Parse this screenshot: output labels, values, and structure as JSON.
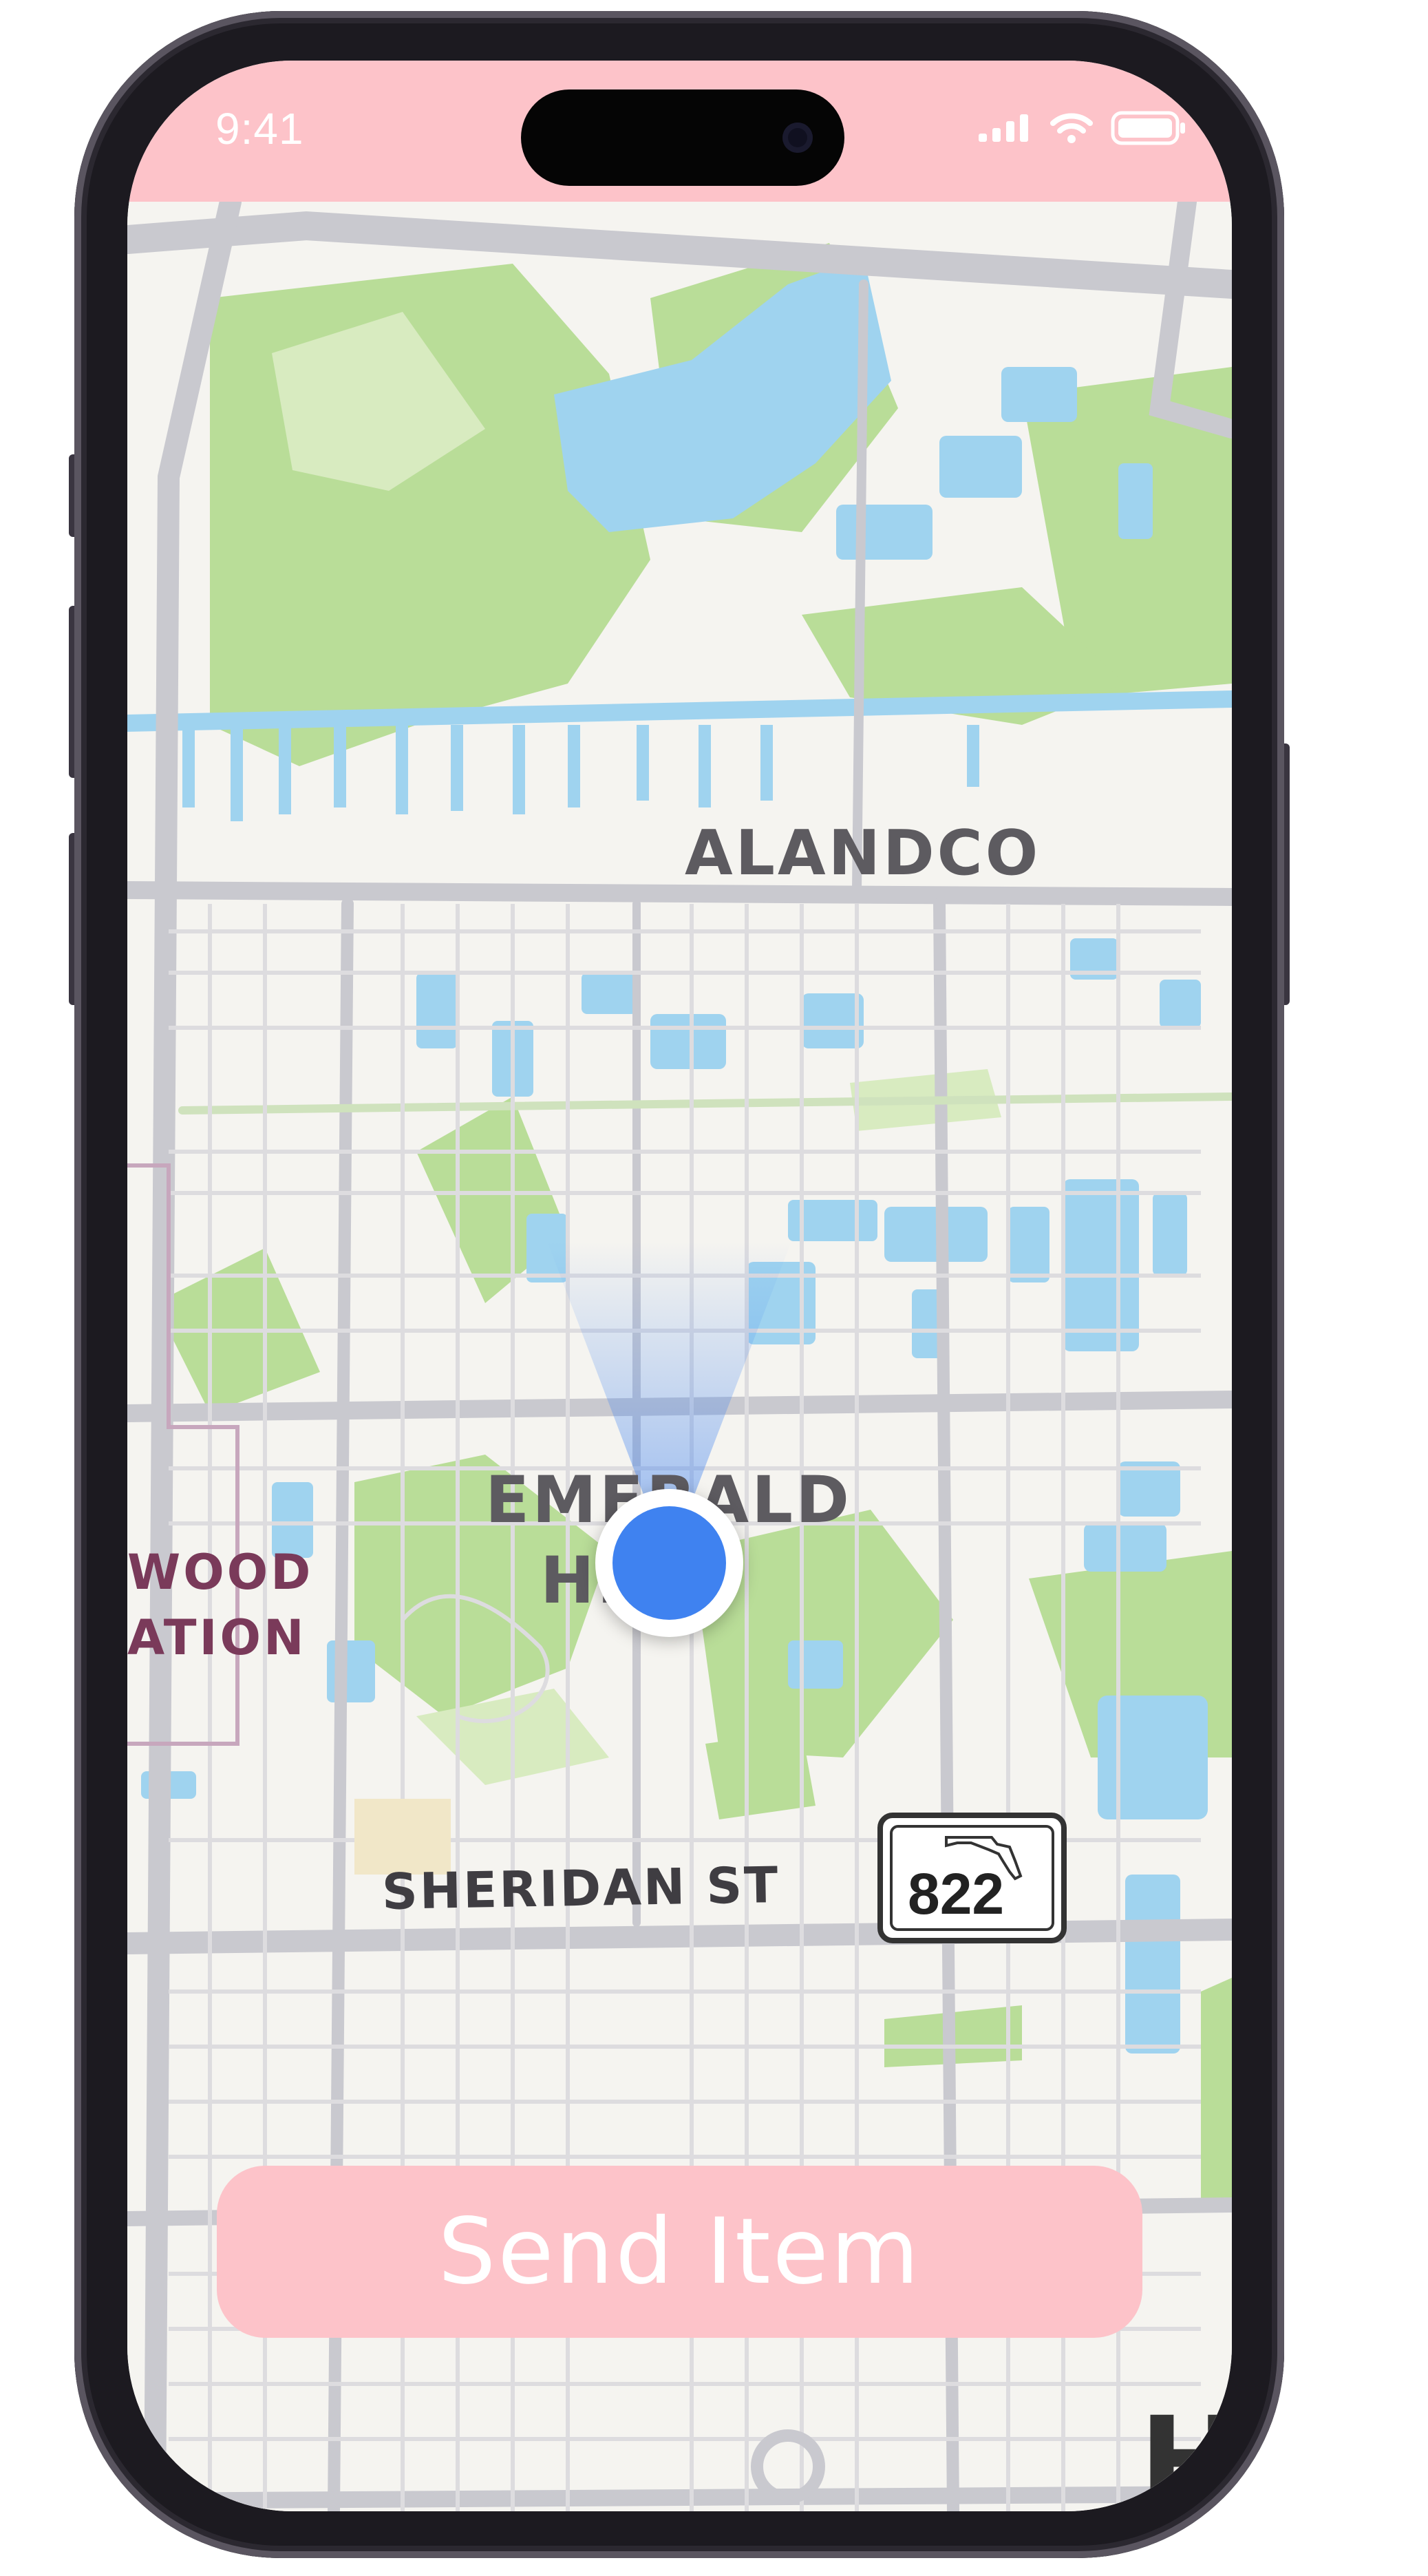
{
  "status_bar": {
    "time": "9:41"
  },
  "map": {
    "labels": {
      "alandco": "ALANDCO",
      "emerald": "EMERALD",
      "emerald_partial": "HI",
      "wood_partial": "WOOD",
      "ation_partial": "ATION",
      "sheridan": "SHERIDAN ST",
      "corner_letter": "H"
    },
    "route_shield": {
      "number": "822"
    }
  },
  "actions": {
    "send_item_label": "Send Item"
  },
  "colors": {
    "accent_pink": "#fdc3c9",
    "location_blue": "#3f82f0",
    "water": "#9fd3ef",
    "park": "#b9dd98",
    "road": "#c9c9cf"
  },
  "icons": [
    "signal-icon",
    "wifi-icon",
    "battery-icon",
    "florida-icon",
    "location-dot"
  ]
}
